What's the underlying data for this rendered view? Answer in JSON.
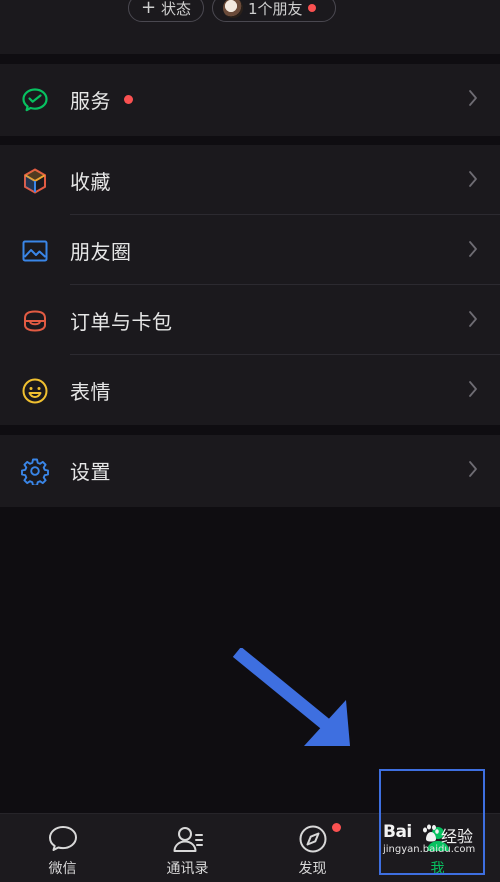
{
  "profile": {
    "status_button": "状态",
    "friends_button": "1个朋友"
  },
  "menu": {
    "service": "服务",
    "favorites": "收藏",
    "moments": "朋友圈",
    "orders_cards": "订单与卡包",
    "stickers": "表情",
    "settings": "设置"
  },
  "tabbar": {
    "chats": "微信",
    "contacts": "通讯录",
    "discover": "发现",
    "me": "我"
  },
  "watermark": {
    "brand": "Bai",
    "suffix": "经验",
    "url": "jingyan.baidu.com"
  },
  "colors": {
    "accent_green": "#07c160",
    "badge_red": "#fa5151",
    "annotation_blue": "#3e6fe0",
    "background": "#0f0d11",
    "card": "#1b191d"
  }
}
